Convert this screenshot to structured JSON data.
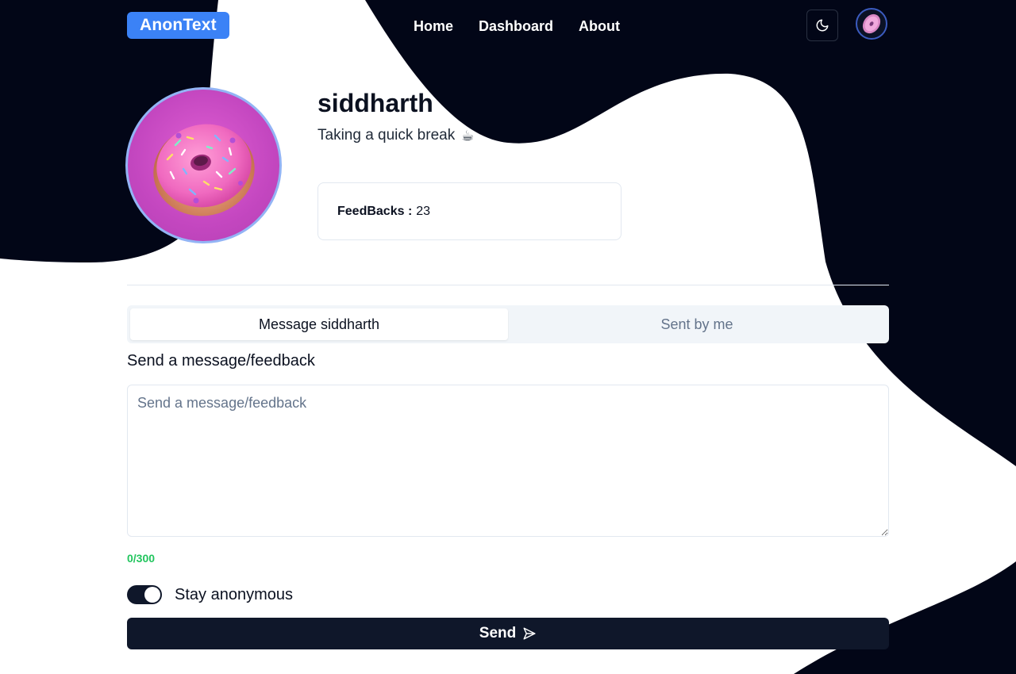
{
  "header": {
    "logo": "AnonText",
    "nav": [
      {
        "label": "Home"
      },
      {
        "label": "Dashboard"
      },
      {
        "label": "About"
      }
    ],
    "theme_icon": "moon-icon",
    "avatar_icon": "donut-avatar"
  },
  "profile": {
    "username": "siddharth",
    "status": "Taking a quick break",
    "status_emoji": "☕",
    "feedback_label": "FeedBacks :",
    "feedback_count": "23"
  },
  "tabs": [
    {
      "label": "Message siddharth",
      "active": true
    },
    {
      "label": "Sent by me",
      "active": false
    }
  ],
  "form": {
    "title": "Send a message/feedback",
    "placeholder": "Send a message/feedback",
    "value": "",
    "counter": "0/300",
    "anonymous_label": "Stay anonymous",
    "anonymous_on": true,
    "send_label": "Send",
    "send_icon": "send-icon"
  },
  "colors": {
    "accent": "#3b82f6",
    "dark": "#020617",
    "counter_green": "#22c55e",
    "button": "#0f172a"
  }
}
